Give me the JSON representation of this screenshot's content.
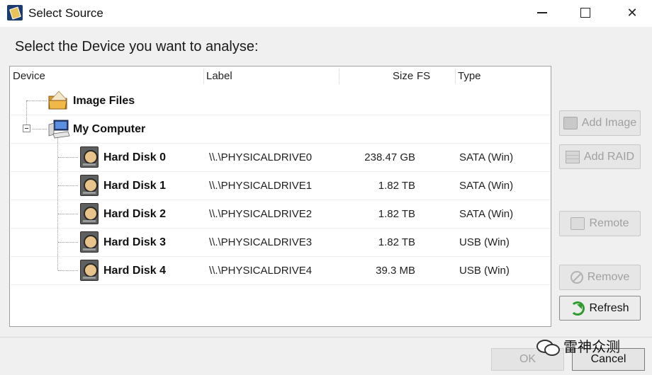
{
  "window": {
    "title": "Select Source",
    "minimize_icon": "minimize-icon",
    "maximize_icon": "maximize-icon",
    "close_glyph": "✕"
  },
  "instruction": "Select the Device you want to analyse:",
  "columns": {
    "device": "Device",
    "label": "Label",
    "size": "Size",
    "fs": "FS",
    "type": "Type"
  },
  "tree": {
    "image_files": {
      "name": "Image Files",
      "icon": "folder-icon"
    },
    "my_computer": {
      "name": "My Computer",
      "icon": "computer-icon",
      "expander": "collapse-icon"
    },
    "disks": [
      {
        "name": "Hard Disk 0",
        "label": "\\\\.\\PHYSICALDRIVE0",
        "size": "238.47 GB",
        "fs": "",
        "type": "SATA (Win)"
      },
      {
        "name": "Hard Disk 1",
        "label": "\\\\.\\PHYSICALDRIVE1",
        "size": "1.82 TB",
        "fs": "",
        "type": "SATA (Win)"
      },
      {
        "name": "Hard Disk 2",
        "label": "\\\\.\\PHYSICALDRIVE2",
        "size": "1.82 TB",
        "fs": "",
        "type": "SATA (Win)"
      },
      {
        "name": "Hard Disk 3",
        "label": "\\\\.\\PHYSICALDRIVE3",
        "size": "1.82 TB",
        "fs": "",
        "type": "USB (Win)"
      },
      {
        "name": "Hard Disk 4",
        "label": "\\\\.\\PHYSICALDRIVE4",
        "size": "39.3 MB",
        "fs": "",
        "type": "USB (Win)"
      }
    ]
  },
  "buttons": {
    "add_image": "Add Image",
    "add_raid": "Add RAID",
    "remote": "Remote",
    "remove": "Remove",
    "refresh": "Refresh",
    "ok": "OK",
    "cancel": "Cancel"
  },
  "watermark": "雷神众测",
  "colors": {
    "accent_green": "#2f9a2f",
    "disabled_text": "#a0a0a0"
  }
}
